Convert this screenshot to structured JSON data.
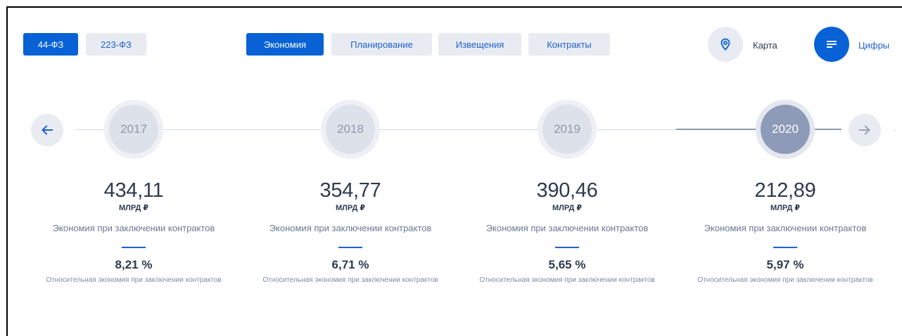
{
  "tabs_law": [
    {
      "label": "44-ФЗ",
      "active": true
    },
    {
      "label": "223-ФЗ",
      "active": false
    }
  ],
  "tabs_section": [
    {
      "label": "Экономия",
      "active": true
    },
    {
      "label": "Планирование",
      "active": false
    },
    {
      "label": "Извещения",
      "active": false
    },
    {
      "label": "Контракты",
      "active": false
    }
  ],
  "view_toggle": {
    "map_label": "Карта",
    "map_icon": "map-pin-icon",
    "numbers_label": "Цифры",
    "numbers_icon": "list-icon"
  },
  "timeline": {
    "prev_icon": "arrow-left-icon",
    "next_icon": "arrow-right-icon",
    "years": [
      {
        "year": "2017",
        "active": false,
        "value": "434,11",
        "unit": "МЛРД ₽",
        "description": "Экономия при заключении контрактов",
        "percent": "8,21 %",
        "percent_description": "Относительная экономия при заключении контрактов"
      },
      {
        "year": "2018",
        "active": false,
        "value": "354,77",
        "unit": "МЛРД ₽",
        "description": "Экономия при заключении контрактов",
        "percent": "6,71 %",
        "percent_description": "Относительная экономия при заключении контрактов"
      },
      {
        "year": "2019",
        "active": false,
        "value": "390,46",
        "unit": "МЛРД ₽",
        "description": "Экономия при заключении контрактов",
        "percent": "5,65 %",
        "percent_description": "Относительная экономия при заключении контрактов"
      },
      {
        "year": "2020",
        "active": true,
        "value": "212,89",
        "unit": "МЛРД ₽",
        "description": "Экономия при заключении контрактов",
        "percent": "5,97 %",
        "percent_description": "Относительная экономия при заключении контрактов"
      }
    ]
  },
  "colors": {
    "accent": "#0862d6",
    "inactive_tab_bg": "#e8ebf2",
    "inactive_tab_text": "#1e61d3",
    "active_year": "#8d9ab8"
  }
}
